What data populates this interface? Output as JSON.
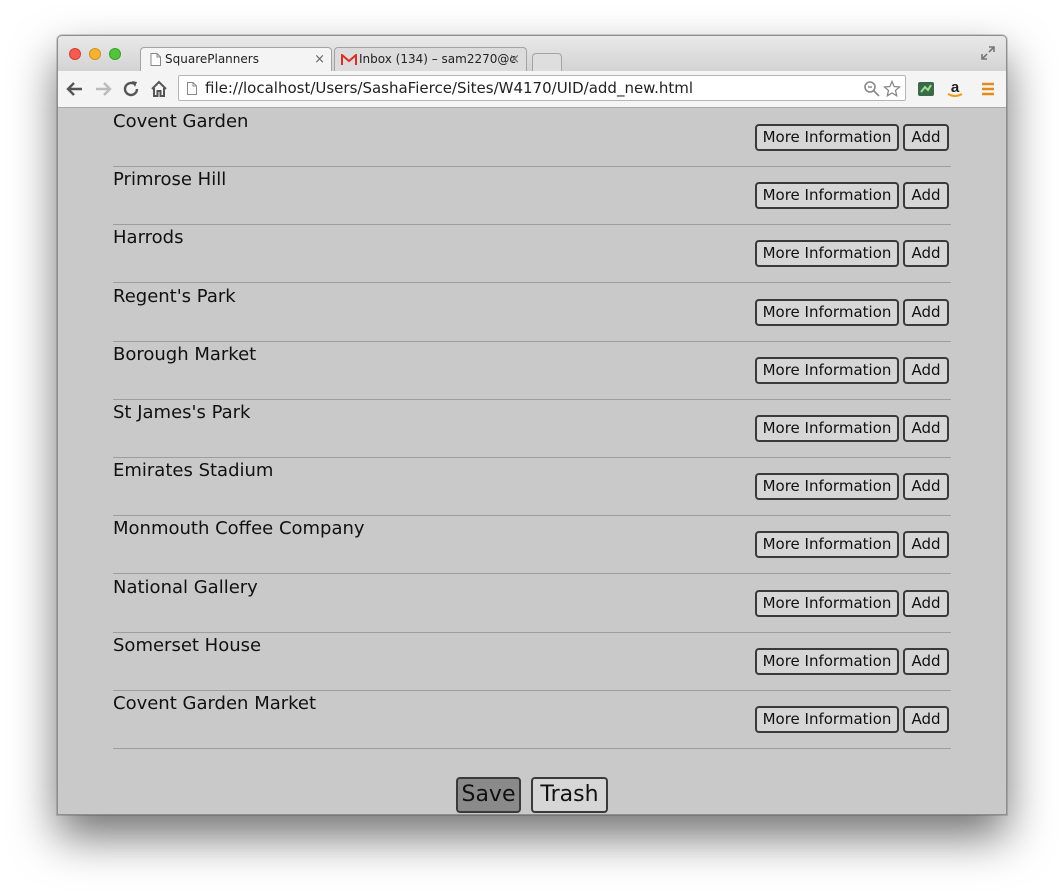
{
  "tabs": [
    {
      "title": "SquarePlanners",
      "close": "×"
    },
    {
      "title": "Inbox (134) – sam2270@c",
      "close": "×"
    }
  ],
  "address_bar": {
    "url": "file://localhost/Users/SashaFierce/Sites/W4170/UID/add_new.html"
  },
  "icons": {
    "back": "back-arrow-icon",
    "forward": "forward-arrow-icon",
    "reload": "reload-icon",
    "home": "home-icon",
    "page": "page-icon",
    "zoom": "zoom-icon",
    "star": "bookmark-star-icon",
    "extension": "extension-icon",
    "amazon": "amazon-icon",
    "menu": "menu-icon",
    "gmail": "gmail-icon"
  },
  "places": [
    {
      "name": "Covent Garden",
      "more_label": "More Information",
      "add_label": "Add"
    },
    {
      "name": "Primrose Hill",
      "more_label": "More Information",
      "add_label": "Add"
    },
    {
      "name": "Harrods",
      "more_label": "More Information",
      "add_label": "Add"
    },
    {
      "name": "Regent's Park",
      "more_label": "More Information",
      "add_label": "Add"
    },
    {
      "name": "Borough Market",
      "more_label": "More Information",
      "add_label": "Add"
    },
    {
      "name": "St James's Park",
      "more_label": "More Information",
      "add_label": "Add"
    },
    {
      "name": "Emirates Stadium",
      "more_label": "More Information",
      "add_label": "Add"
    },
    {
      "name": "Monmouth Coffee Company",
      "more_label": "More Information",
      "add_label": "Add"
    },
    {
      "name": "National Gallery",
      "more_label": "More Information",
      "add_label": "Add"
    },
    {
      "name": "Somerset House",
      "more_label": "More Information",
      "add_label": "Add"
    },
    {
      "name": "Covent Garden Market",
      "more_label": "More Information",
      "add_label": "Add"
    }
  ],
  "footer": {
    "save_label": "Save",
    "trash_label": "Trash"
  }
}
